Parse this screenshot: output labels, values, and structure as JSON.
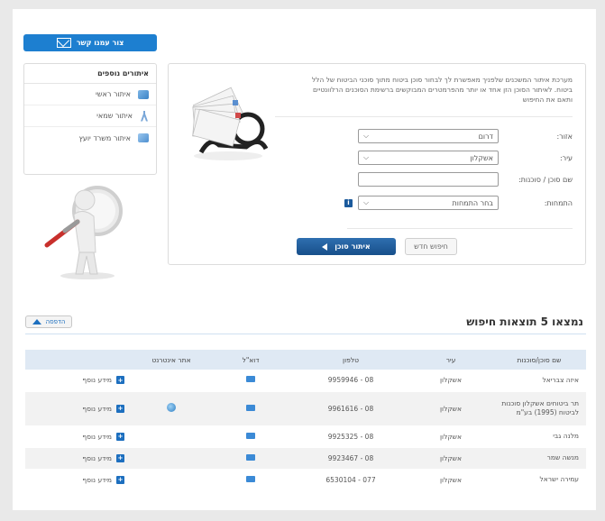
{
  "contact_button": {
    "label": "צור עמנו קשר",
    "icon": "envelope-icon"
  },
  "side_panel": {
    "title": "איתורים נוספים",
    "items": [
      {
        "label": "איתור ראשי",
        "icon": "map-icon"
      },
      {
        "label": "איתור שמאי",
        "icon": "surveyor-icon"
      },
      {
        "label": "איתור משרד יועץ",
        "icon": "advisor-icon"
      }
    ]
  },
  "search": {
    "intro": "מערכת איתור המשכנים שלפניך מאפשרת לך לבחור סוכן ביטוח מתוך סוכני הביטוח של הלל ביטוח. לאיתור הסוכן הזן אחד או יותר מהפרמטרים המבוקשים ברשימת הסוכנים הרלוונטיים ותאם את החיפוש",
    "fields": [
      {
        "label": "אזור:",
        "value": "דרום"
      },
      {
        "label": "עיר:",
        "value": "אשקלון"
      },
      {
        "label": "שם סוכן / סוכנות:",
        "value": ""
      },
      {
        "label": "התמחות:",
        "value": "בחר התמחות"
      }
    ],
    "search_button": "איתור סוכן",
    "new_search_button": "חיפוש חדש"
  },
  "results": {
    "title": "נמצאו 5 תוצאות חיפוש",
    "print_label": "הדפסה",
    "columns": [
      "שם סוכן/סוכנות",
      "עיר",
      "טלפון",
      "דוא\"ל",
      "אתר אינטרנט",
      ""
    ],
    "rows": [
      {
        "name": "איזה צבריאל",
        "city": "אשקלון",
        "phone": "08 - 9959946",
        "has_web": false,
        "more": "מידע נוסף"
      },
      {
        "name": "תר ביטוחים אשקלון סוכנות לביטוח (1995) בע\"מ",
        "city": "אשקלון",
        "phone": "08 - 9961616",
        "has_web": true,
        "more": "מידע נוסף"
      },
      {
        "name": "מלנה גבי",
        "city": "אשקלון",
        "phone": "08 - 9925325",
        "has_web": false,
        "more": "מידע נוסף"
      },
      {
        "name": "מנשה שמר",
        "city": "אשקלון",
        "phone": "08 - 9923467",
        "has_web": false,
        "more": "מידע נוסף"
      },
      {
        "name": "עמירה ישראל",
        "city": "אשקלון",
        "phone": "077 - 6530104",
        "has_web": false,
        "more": "מידע נוסף"
      }
    ]
  },
  "colors": {
    "accent": "#1d7fd0",
    "dark_button": "#174f8a",
    "table_header": "#dfe9f4"
  }
}
